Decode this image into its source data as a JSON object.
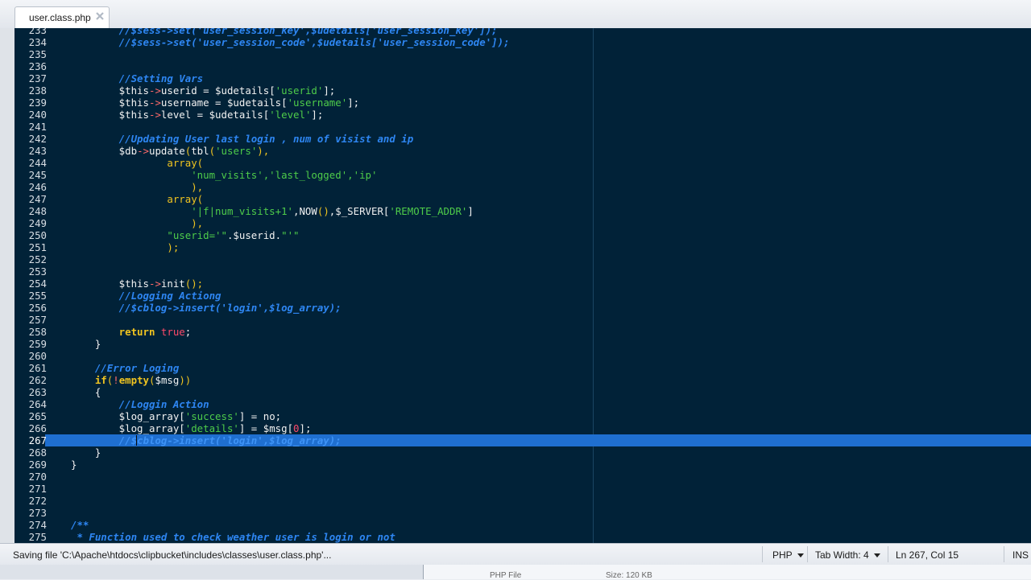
{
  "tab": {
    "title": "user.class.php"
  },
  "editor": {
    "lines": [
      {
        "n": "233",
        "segs": [
          {
            "t": "        //$sess->set('user_session_key',$udetails['user_session_key']);",
            "c": "cm"
          }
        ]
      },
      {
        "n": "234",
        "segs": [
          {
            "t": "        //$sess->set('user_session_code',$udetails['user_session_code']);",
            "c": "cm"
          }
        ]
      },
      {
        "n": "235",
        "segs": []
      },
      {
        "n": "236",
        "segs": []
      },
      {
        "n": "237",
        "segs": [
          {
            "t": "        //Setting Vars",
            "c": "cm"
          }
        ]
      },
      {
        "n": "238",
        "segs": [
          {
            "t": "        $this",
            "c": "v"
          },
          {
            "t": "->",
            "c": "o"
          },
          {
            "t": "userid = $udetails",
            "c": "v"
          },
          {
            "t": "[",
            "c": "b"
          },
          {
            "t": "'userid'",
            "c": "s"
          },
          {
            "t": "];",
            "c": "b"
          }
        ]
      },
      {
        "n": "239",
        "segs": [
          {
            "t": "        $this",
            "c": "v"
          },
          {
            "t": "->",
            "c": "o"
          },
          {
            "t": "username = $udetails",
            "c": "v"
          },
          {
            "t": "[",
            "c": "b"
          },
          {
            "t": "'username'",
            "c": "s"
          },
          {
            "t": "];",
            "c": "b"
          }
        ]
      },
      {
        "n": "240",
        "segs": [
          {
            "t": "        $this",
            "c": "v"
          },
          {
            "t": "->",
            "c": "o"
          },
          {
            "t": "level = $udetails",
            "c": "v"
          },
          {
            "t": "[",
            "c": "b"
          },
          {
            "t": "'level'",
            "c": "s"
          },
          {
            "t": "];",
            "c": "b"
          }
        ]
      },
      {
        "n": "241",
        "segs": []
      },
      {
        "n": "242",
        "segs": [
          {
            "t": "        //Updating User last login , num of visist and ip",
            "c": "cm"
          }
        ]
      },
      {
        "n": "243",
        "segs": [
          {
            "t": "        $db",
            "c": "v"
          },
          {
            "t": "->",
            "c": "o"
          },
          {
            "t": "update",
            "c": "v"
          },
          {
            "t": "(",
            "c": "p"
          },
          {
            "t": "tbl",
            "c": "v"
          },
          {
            "t": "(",
            "c": "p"
          },
          {
            "t": "'users'",
            "c": "s"
          },
          {
            "t": "),",
            "c": "p"
          }
        ]
      },
      {
        "n": "244",
        "segs": [
          {
            "t": "                array",
            "c": "fn"
          },
          {
            "t": "(",
            "c": "p"
          }
        ]
      },
      {
        "n": "245",
        "segs": [
          {
            "t": "                    'num_visits','last_logged','ip'",
            "c": "s"
          }
        ]
      },
      {
        "n": "246",
        "segs": [
          {
            "t": "                    ),",
            "c": "p"
          }
        ]
      },
      {
        "n": "247",
        "segs": [
          {
            "t": "                array",
            "c": "fn"
          },
          {
            "t": "(",
            "c": "p"
          }
        ]
      },
      {
        "n": "248",
        "segs": [
          {
            "t": "                    '|f|num_visits+1'",
            "c": "s"
          },
          {
            "t": ",NOW",
            "c": "v"
          },
          {
            "t": "()",
            "c": "p"
          },
          {
            "t": ",$_SERVER",
            "c": "v"
          },
          {
            "t": "[",
            "c": "b"
          },
          {
            "t": "'REMOTE_ADDR'",
            "c": "s"
          },
          {
            "t": "]",
            "c": "b"
          }
        ]
      },
      {
        "n": "249",
        "segs": [
          {
            "t": "                    ),",
            "c": "p"
          }
        ]
      },
      {
        "n": "250",
        "segs": [
          {
            "t": "                \"userid='\"",
            "c": "s"
          },
          {
            "t": ".$userid.",
            "c": "v"
          },
          {
            "t": "\"'\"",
            "c": "s"
          }
        ]
      },
      {
        "n": "251",
        "segs": [
          {
            "t": "                );",
            "c": "p"
          }
        ]
      },
      {
        "n": "252",
        "segs": []
      },
      {
        "n": "253",
        "segs": []
      },
      {
        "n": "254",
        "segs": [
          {
            "t": "        $this",
            "c": "v"
          },
          {
            "t": "->",
            "c": "o"
          },
          {
            "t": "init",
            "c": "v"
          },
          {
            "t": "();",
            "c": "p"
          }
        ]
      },
      {
        "n": "255",
        "segs": [
          {
            "t": "        //Logging Actiong",
            "c": "cm"
          }
        ]
      },
      {
        "n": "256",
        "segs": [
          {
            "t": "        //$cblog->insert('login',$log_array);",
            "c": "cm"
          }
        ]
      },
      {
        "n": "257",
        "segs": []
      },
      {
        "n": "258",
        "segs": [
          {
            "t": "        return",
            "c": "kw"
          },
          {
            "t": " ",
            "c": "v"
          },
          {
            "t": "true",
            "c": "bool"
          },
          {
            "t": ";",
            "c": "v"
          }
        ]
      },
      {
        "n": "259",
        "segs": [
          {
            "t": "    }",
            "c": "v"
          }
        ]
      },
      {
        "n": "260",
        "segs": []
      },
      {
        "n": "261",
        "segs": [
          {
            "t": "    //Error Loging",
            "c": "cm"
          }
        ]
      },
      {
        "n": "262",
        "segs": [
          {
            "t": "    if",
            "c": "kw"
          },
          {
            "t": "(",
            "c": "p"
          },
          {
            "t": "!",
            "c": "o"
          },
          {
            "t": "empty",
            "c": "kw"
          },
          {
            "t": "(",
            "c": "p"
          },
          {
            "t": "$msg",
            "c": "v"
          },
          {
            "t": "))",
            "c": "p"
          }
        ]
      },
      {
        "n": "263",
        "segs": [
          {
            "t": "    {",
            "c": "v"
          }
        ]
      },
      {
        "n": "264",
        "segs": [
          {
            "t": "        //Loggin Action",
            "c": "cm"
          }
        ]
      },
      {
        "n": "265",
        "segs": [
          {
            "t": "        $log_array",
            "c": "v"
          },
          {
            "t": "[",
            "c": "b"
          },
          {
            "t": "'success'",
            "c": "s"
          },
          {
            "t": "] = no;",
            "c": "b"
          }
        ]
      },
      {
        "n": "266",
        "segs": [
          {
            "t": "        $log_array",
            "c": "v"
          },
          {
            "t": "[",
            "c": "b"
          },
          {
            "t": "'details'",
            "c": "s"
          },
          {
            "t": "] = $msg",
            "c": "b"
          },
          {
            "t": "[",
            "c": "b"
          },
          {
            "t": "0",
            "c": "num"
          },
          {
            "t": "];",
            "c": "b"
          }
        ]
      },
      {
        "n": "267",
        "hl": true,
        "segs": [
          {
            "t": "        //$cblog->insert('login',$log_array);",
            "c": "hlcm"
          }
        ]
      },
      {
        "n": "268",
        "segs": [
          {
            "t": "    }",
            "c": "v"
          }
        ]
      },
      {
        "n": "269",
        "segs": [
          {
            "t": "}",
            "c": "v"
          }
        ]
      },
      {
        "n": "270",
        "segs": []
      },
      {
        "n": "271",
        "segs": []
      },
      {
        "n": "272",
        "segs": []
      },
      {
        "n": "273",
        "segs": []
      },
      {
        "n": "274",
        "segs": [
          {
            "t": "/**",
            "c": "cm"
          }
        ]
      },
      {
        "n": "275",
        "segs": [
          {
            "t": " * Function used to check weather user is login or not",
            "c": "cm"
          }
        ]
      }
    ]
  },
  "status": {
    "message": "Saving file 'C:\\Apache\\htdocs\\clipbucket\\includes\\classes\\user.class.php'...",
    "language": "PHP",
    "tab_width": "Tab Width: 4",
    "position": "Ln 267, Col 15",
    "mode": "INS"
  },
  "taskbar": {
    "file_type": "PHP File",
    "size": "Size: 120 KB"
  },
  "colors": {
    "background": "#012238",
    "comment": "#2e86f2",
    "string": "#4ecc4a",
    "keyword": "#f0c420",
    "boolean": "#ff4a6a",
    "operator": "#ff6a6a",
    "selection": "#1f6fd0"
  }
}
